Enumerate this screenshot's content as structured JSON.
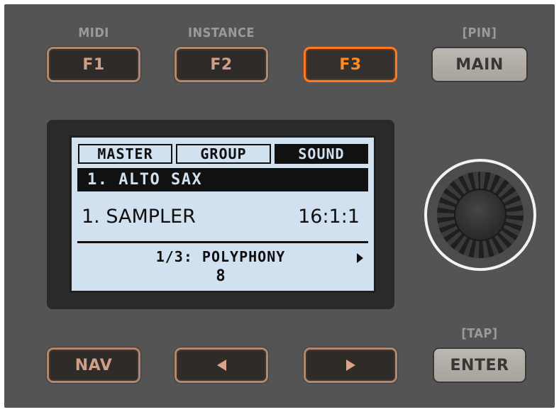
{
  "function_buttons": {
    "f1": {
      "label": "F1",
      "caption": "MIDI"
    },
    "f2": {
      "label": "F2",
      "caption": "INSTANCE"
    },
    "f3": {
      "label": "F3",
      "caption": ""
    },
    "main": {
      "label": "MAIN",
      "caption": "[PIN]"
    }
  },
  "display": {
    "tabs": [
      "MASTER",
      "GROUP",
      "SOUND"
    ],
    "selected_tab": "SOUND",
    "header": "1. ALTO SAX",
    "plugin_name": "1. SAMPLER",
    "plugin_position": "16:1:1",
    "parameter_label": "1/3: POLYPHONY",
    "parameter_value": "8"
  },
  "bottom_buttons": {
    "nav": {
      "label": "NAV"
    },
    "left": {
      "icon": "left-arrow-icon"
    },
    "right": {
      "icon": "right-arrow-icon"
    },
    "enter": {
      "label": "ENTER",
      "caption": "[TAP]"
    }
  },
  "colors": {
    "panel": "#545454",
    "button_border": "#b08a70",
    "active_border": "#ff7a1f",
    "screen_bg": "#d2e1ef"
  }
}
